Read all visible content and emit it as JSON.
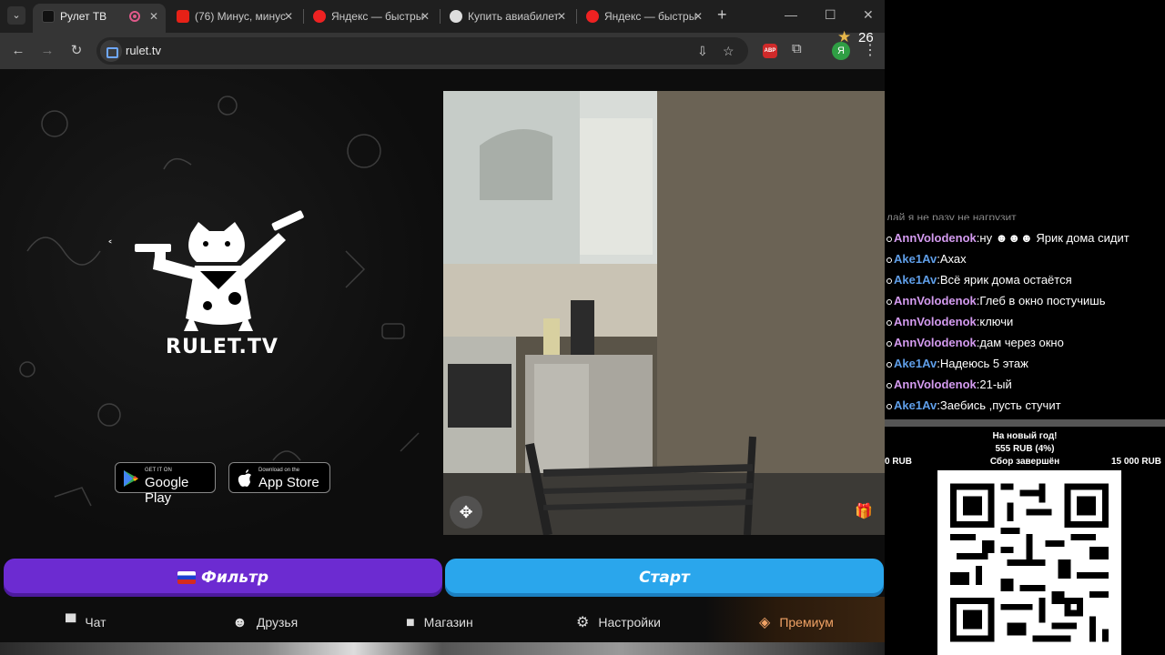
{
  "browser": {
    "tabs": [
      {
        "title": "Рулет ТВ",
        "active": true,
        "icon": "rulet-favicon",
        "recording": true
      },
      {
        "title": "(76) Минус, минус",
        "icon": "youtube-icon"
      },
      {
        "title": "Яндекс — быстры",
        "icon": "yandex-icon"
      },
      {
        "title": "Купить авиабилет",
        "icon": "aviasales-icon"
      },
      {
        "title": "Яндекс — быстры",
        "icon": "yandex-icon"
      }
    ],
    "url": "rulet.tv",
    "abp_label": "ABP",
    "profile_letter": "Я"
  },
  "page": {
    "logo_text": "RULET.TV",
    "google_play": {
      "small": "GET IT ON",
      "big": "Google Play"
    },
    "app_store": {
      "small": "Download on the",
      "big": "App Store"
    },
    "stars": "26",
    "filter_label": "Фильтр",
    "start_label": "Старт",
    "nav": [
      {
        "label": "Чат",
        "icon": "chat-icon"
      },
      {
        "label": "Друзья",
        "icon": "friends-icon"
      },
      {
        "label": "Магазин",
        "icon": "shop-bag-icon"
      },
      {
        "label": "Настройки",
        "icon": "gear-icon"
      },
      {
        "label": "Премиум",
        "icon": "tag-icon"
      }
    ]
  },
  "stream_overlay": {
    "chat_cutoff": "дай я не разу не нагрузит",
    "messages": [
      {
        "user": "AnnVolodenok",
        "text": "ну ☻☻☻ Ярик дома сидит"
      },
      {
        "user": "Ake1Av",
        "text": "Ахах"
      },
      {
        "user": "Ake1Av",
        "text": "Всё ярик дома остаётся"
      },
      {
        "user": "AnnVolodenok",
        "text": "Глеб в окно постучишь"
      },
      {
        "user": "AnnVolodenok",
        "text": "ключи"
      },
      {
        "user": "AnnVolodenok",
        "text": "дам через окно"
      },
      {
        "user": "Ake1Av",
        "text": "Надеюсь 5 этаж"
      },
      {
        "user": "AnnVolodenok",
        "text": "21-ый"
      },
      {
        "user": "Ake1Av",
        "text": "Заебись ,пусть стучит"
      }
    ],
    "donation": {
      "title": "На новый год!",
      "amount": "555 RUB (4%)",
      "min": "0 RUB",
      "status": "Сбор завершён",
      "goal": "15 000 RUB",
      "progress": 0.04
    }
  }
}
